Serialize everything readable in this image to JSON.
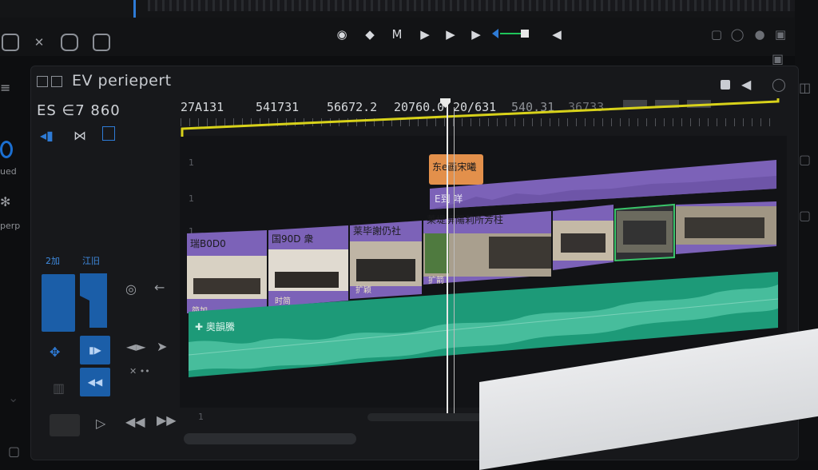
{
  "toolbar": {
    "left_icons": [
      "square-icon",
      "close-icon",
      "gear-square-icon",
      "grid-square-icon"
    ],
    "transport_icons": [
      "circle-icon",
      "flag-icon",
      "marker-icon",
      "play-icon",
      "play-icon",
      "step-icon",
      "trim-icon",
      "speaker-icon"
    ]
  },
  "panel": {
    "title": "EV periepert",
    "timecode": "ES ∈7 860"
  },
  "ruler": {
    "labels": [
      "27A131",
      "541731",
      "56672.2",
      "20760.0",
      "20/631",
      "540.31",
      "36733",
      "1"
    ]
  },
  "tracks": {
    "track_numbers": [
      "1",
      "1",
      "1",
      "1"
    ],
    "overlay_clip": "东e画宋曦",
    "purple_clip_label": "E到 咩",
    "video_clips": [
      {
        "label": "瑞B0D0",
        "foot": "简加"
      },
      {
        "label": "国90D 衆",
        "foot": "时简"
      },
      {
        "label": "莱毕謝仍社",
        "foot": "扩颖"
      },
      {
        "label": "莱堤屏陽莉所芳柱",
        "foot": "扩箭"
      }
    ],
    "audio_label": "✚ 奧韻騰"
  },
  "left_panel": {
    "labels": [
      "Zoo",
      "ued",
      "perp",
      "2加",
      "江旧"
    ],
    "small_text": "✕ ••"
  },
  "colors": {
    "accent_blue": "#2e7bd6",
    "ruler_yellow": "#d8d21a",
    "clip_purple": "#7c62b8",
    "clip_orange": "#e3904b",
    "audio_green": "#1d9a78"
  }
}
